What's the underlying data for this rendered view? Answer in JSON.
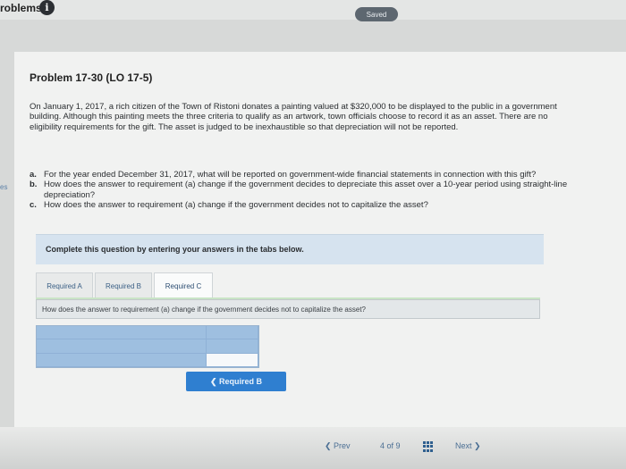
{
  "header": {
    "title": "roblems",
    "saved_label": "Saved"
  },
  "side_mark": "es",
  "problem": {
    "title": "Problem 17-30 (LO 17-5)",
    "text": "On January 1, 2017, a rich citizen of the Town of Ristoni donates a painting valued at $320,000 to be displayed to the public in a government building. Although this painting meets the three criteria to qualify as an artwork, town officials choose to record it as an asset. There are no eligibility requirements for the gift. The asset is judged to be inexhaustible so that depreciation will not be reported.",
    "questions": [
      {
        "letter": "a.",
        "text": "For the year ended December 31, 2017, what will be reported on government-wide financial statements in connection with this gift?"
      },
      {
        "letter": "b.",
        "text": "How does the answer to requirement (a) change if the government decides to depreciate this asset over a 10-year period using straight-line depreciation?"
      },
      {
        "letter": "c.",
        "text": "How does the answer to requirement (a) change if the government decides not to capitalize the asset?"
      }
    ]
  },
  "instructions": "Complete this question by entering your answers in the tabs below.",
  "tabs": [
    {
      "label": "Required A",
      "active": false
    },
    {
      "label": "Required B",
      "active": false
    },
    {
      "label": "Required C",
      "active": true
    }
  ],
  "requirement_prompt": "How does the answer to requirement (a) change if the government decides not to capitalize the asset?",
  "back_button": "❮  Required B",
  "pager": {
    "prev": "❮  Prev",
    "position": "4 of 9",
    "next": "Next  ❯"
  },
  "icons": {
    "info": "info-icon",
    "grid": "grid-icon"
  },
  "colors": {
    "accent": "#2f7fd0",
    "banner": "#d6e3ef",
    "grid_fill": "#9ebfe0"
  }
}
